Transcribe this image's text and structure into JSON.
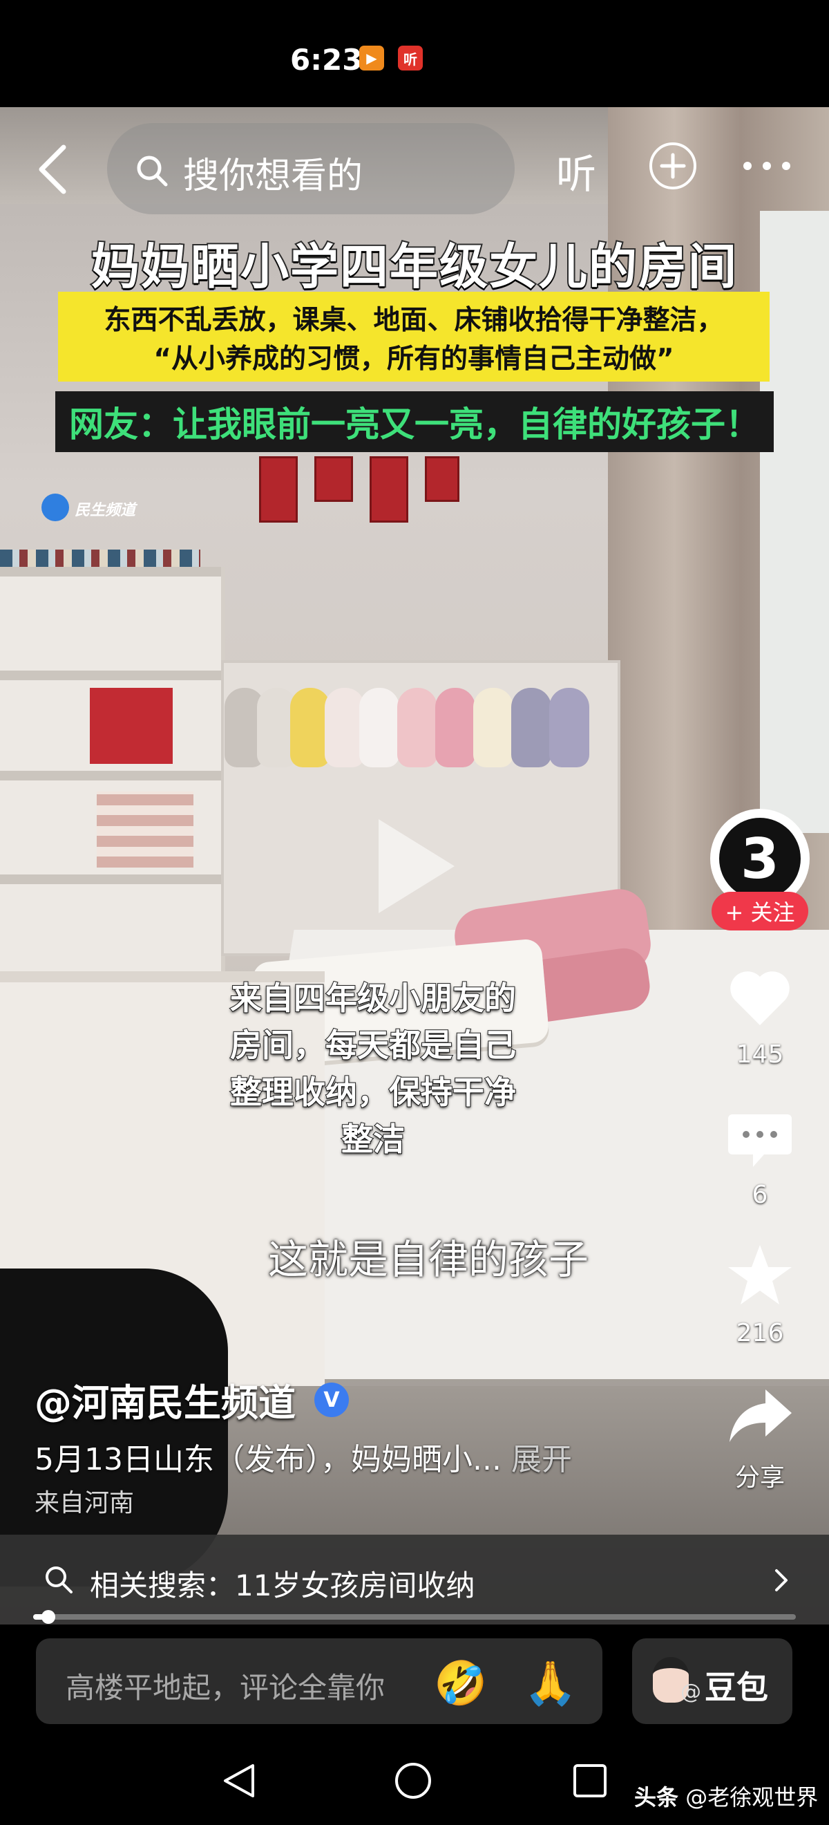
{
  "status_bar": {
    "time": "6:23",
    "app_badge_1": "▶",
    "app_badge_2": "听"
  },
  "top_nav": {
    "search_placeholder": "搜你想看的",
    "listen_label": "听"
  },
  "video_overlay": {
    "title": "妈妈晒小学四年级女儿的房间",
    "subtitle_line_1": "东西不乱丢放，课桌、地面、床铺收拾得干净整洁，",
    "subtitle_line_2": "“从小养成的习惯，所有的事情自己主动做”",
    "netizen_comment": "网友：让我眼前一亮又一亮，自律的好孩子！",
    "channel_logo": "民生频道",
    "caption_lines": [
      "来自四年级小朋友的",
      "房间，每天都是自己",
      "整理收纳，保持干净",
      "整洁"
    ],
    "caption_main": "这就是自律的孩子"
  },
  "action_rail": {
    "avatar_text": "3",
    "follow_label": "+ 关注",
    "like_count": "145",
    "comment_count": "6",
    "favorite_count": "216",
    "share_label": "分享"
  },
  "video_info": {
    "author": "@河南民生频道",
    "verified": "V",
    "description": "5月13日山东（发布），妈妈晒小...",
    "expand_label": "展开",
    "location": "来自河南"
  },
  "related_search": {
    "text": "相关搜索：11岁女孩房间收纳"
  },
  "progress": {
    "fraction": 0.02
  },
  "comment_bar": {
    "placeholder": "高楼平地起，评论全靠你",
    "emoji_1": "🤣",
    "emoji_2": "🙏",
    "doubao_label": "豆包",
    "doubao_at": "@"
  },
  "watermark": {
    "brand": "头条",
    "account": "@老徐观世界"
  },
  "colors": {
    "follow_red": "#f0384a",
    "verified_blue": "#3b7cf0",
    "banner_yellow": "#f5e52c",
    "banner_green_text": "#3ee07a"
  }
}
